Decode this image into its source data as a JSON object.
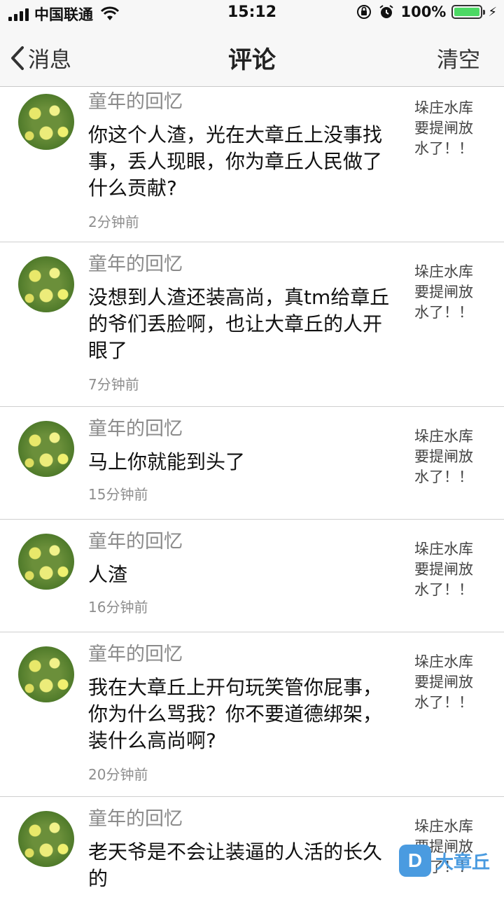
{
  "status_bar": {
    "carrier": "中国联通",
    "time": "15:12",
    "battery_percent": "100%",
    "battery_level": 1.0
  },
  "nav": {
    "back_label": "消息",
    "title": "评论",
    "clear_label": "清空"
  },
  "comments": [
    {
      "user": "童年的回忆",
      "text": "你这个人渣，光在大章丘上没事找事，丢人现眼，你为章丘人民做了什么贡献?",
      "time": "2分钟前",
      "ref": "垛庄水库要提闸放水了！！"
    },
    {
      "user": "童年的回忆",
      "text": "没想到人渣还装高尚，真tm给章丘的爷们丢脸啊，也让大章丘的人开眼了",
      "time": "7分钟前",
      "ref": "垛庄水库要提闸放水了！！"
    },
    {
      "user": "童年的回忆",
      "text": "马上你就能到头了",
      "time": "15分钟前",
      "ref": "垛庄水库要提闸放水了！！"
    },
    {
      "user": "童年的回忆",
      "text": "人渣",
      "time": "16分钟前",
      "ref": "垛庄水库要提闸放水了！！"
    },
    {
      "user": "童年的回忆",
      "text": "我在大章丘上开句玩笑管你屁事，你为什么骂我？你不要道德绑架，装什么高尚啊?",
      "time": "20分钟前",
      "ref": "垛庄水库要提闸放水了！！"
    },
    {
      "user": "童年的回忆",
      "text": "老天爷是不会让装逼的人活的长久的",
      "time": "",
      "ref": "垛庄水库要提闸放水了！！"
    }
  ],
  "watermark": {
    "logo_letter": "D",
    "text": "大章丘"
  }
}
